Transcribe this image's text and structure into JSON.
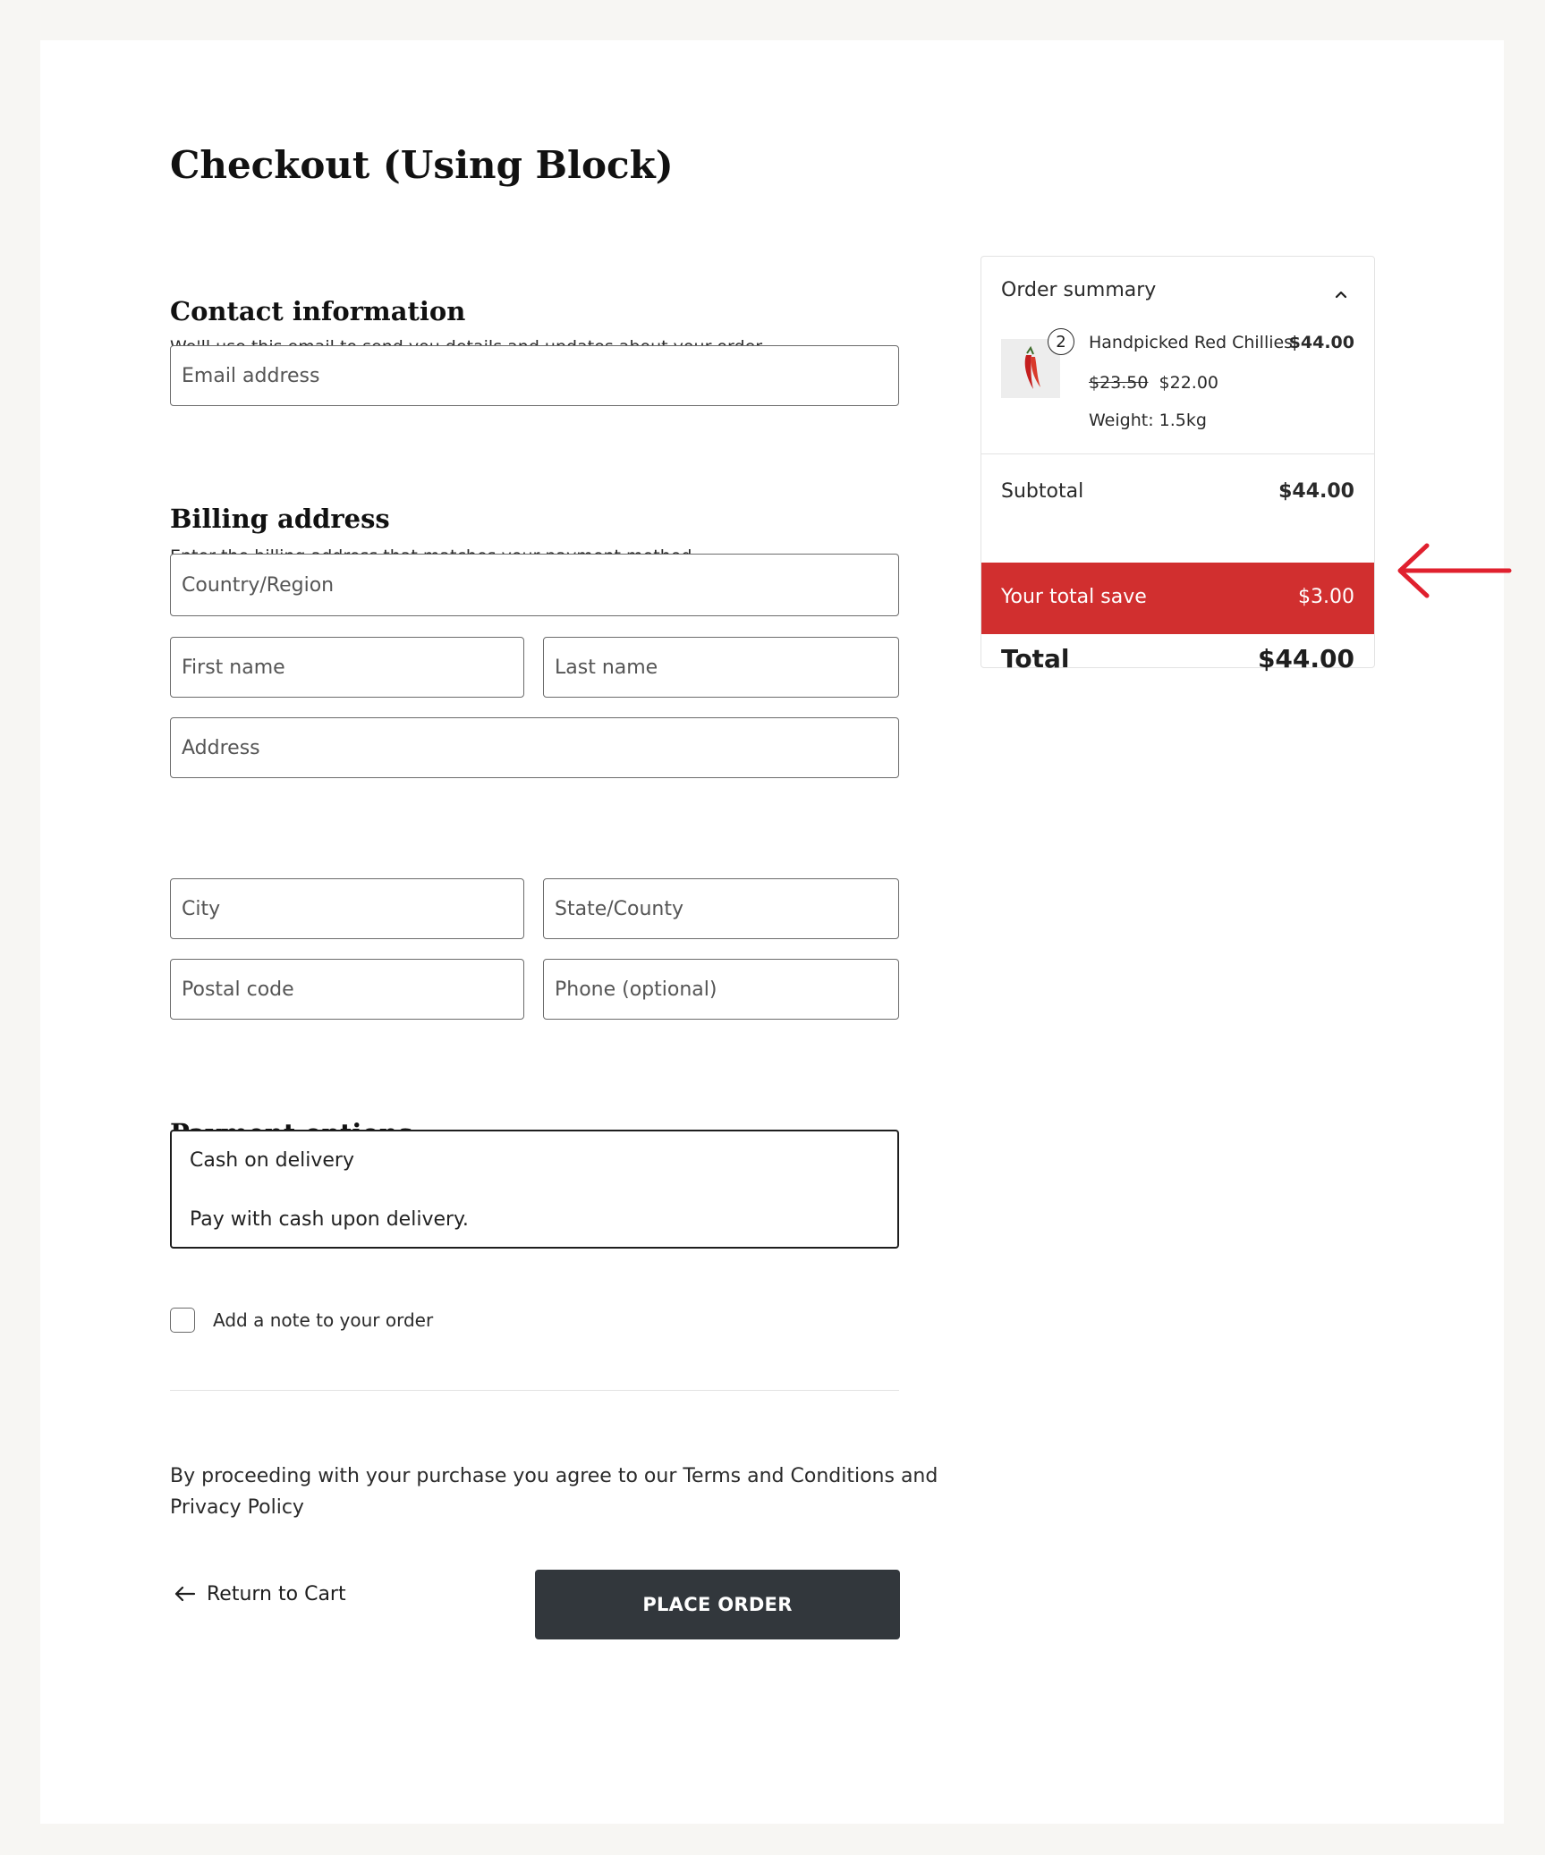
{
  "page": {
    "title": "Checkout (Using Block)"
  },
  "contact": {
    "heading": "Contact information",
    "description": "We'll use this email to send you details and updates about your order.",
    "email_placeholder": "Email address"
  },
  "billing": {
    "heading": "Billing address",
    "description": "Enter the billing address that matches your payment method.",
    "country_placeholder": "Country/Region",
    "first_name_placeholder": "First name",
    "last_name_placeholder": "Last name",
    "address_placeholder": "Address",
    "city_placeholder": "City",
    "state_placeholder": "State/County",
    "postal_placeholder": "Postal code",
    "phone_placeholder": "Phone (optional)"
  },
  "payment": {
    "heading": "Payment options",
    "method_label": "Cash on delivery",
    "method_description": "Pay with cash upon delivery."
  },
  "order_note": {
    "label": "Add a note to your order"
  },
  "terms": {
    "line1": "By proceeding with your purchase you agree to our Terms and Conditions and",
    "line2": "Privacy Policy"
  },
  "actions": {
    "return_label": "Return to Cart",
    "place_order_label": "PLACE ORDER"
  },
  "summary": {
    "heading": "Order summary",
    "item": {
      "name": "Handpicked Red Chillies",
      "line_total": "$44.00",
      "quantity": "2",
      "regular_price": "$23.50",
      "sale_price": "$22.00",
      "meta": "Weight: 1.5kg"
    },
    "subtotal_label": "Subtotal",
    "subtotal_value": "$44.00",
    "save_label": "Your total save",
    "save_value": "$3.00",
    "total_label": "Total",
    "total_value": "$44.00"
  },
  "colors": {
    "accent_red": "#d12f2f",
    "annotation_arrow": "#e0202e",
    "button_dark": "#32373c"
  },
  "icons": {
    "collapse": "chevron-up-icon",
    "back": "arrow-left-icon",
    "annotation": "arrow-left-annotation-icon"
  }
}
